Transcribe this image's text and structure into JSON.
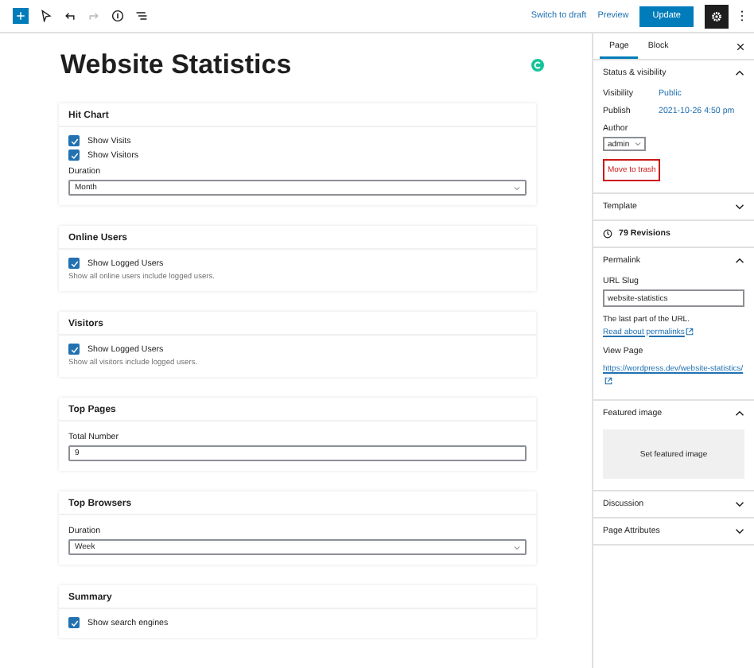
{
  "toolbar": {
    "switch_to_draft": "Switch to draft",
    "preview": "Preview",
    "update": "Update",
    "settings_selected": true
  },
  "title": "Website Statistics",
  "sections": [
    {
      "title": "Hit Chart",
      "fields": [
        {
          "kind": "checkbox",
          "label": "Show Visits",
          "checked": true
        },
        {
          "kind": "checkbox",
          "label": "Show Visitors",
          "checked": true
        },
        {
          "kind": "select",
          "label": "Duration",
          "value": "Month"
        }
      ]
    },
    {
      "title": "Online Users",
      "fields": [
        {
          "kind": "checkbox",
          "label": "Show Logged Users",
          "checked": true
        },
        {
          "kind": "help",
          "text": "Show all online users include logged users."
        }
      ]
    },
    {
      "title": "Visitors",
      "fields": [
        {
          "kind": "checkbox",
          "label": "Show Logged Users",
          "checked": true
        },
        {
          "kind": "help",
          "text": "Show all visitors include logged users."
        }
      ]
    },
    {
      "title": "Top Pages",
      "fields": [
        {
          "kind": "number",
          "label": "Total Number",
          "value": "9"
        }
      ]
    },
    {
      "title": "Top Browsers",
      "fields": [
        {
          "kind": "select",
          "label": "Duration",
          "value": "Week"
        }
      ]
    },
    {
      "title": "Summary",
      "fields": [
        {
          "kind": "checkbox",
          "label": "Show search engines",
          "checked": true
        }
      ]
    }
  ],
  "sidebar": {
    "tabs": [
      {
        "label": "Page",
        "selected": true
      },
      {
        "label": "Block",
        "selected": false
      }
    ],
    "panels": [
      {
        "kind": "status",
        "title": "Status & visibility",
        "expanded": true,
        "rows": [
          {
            "label": "Visibility",
            "value": "Public"
          },
          {
            "label": "Publish",
            "value": "2021-10-26 4:50 pm"
          }
        ],
        "author_label": "Author",
        "author": "admin",
        "trash": "Move to trash"
      },
      {
        "kind": "plain",
        "title": "Template",
        "expanded": false
      },
      {
        "kind": "revisions",
        "text": "79 Revisions"
      },
      {
        "kind": "permalink",
        "title": "Permalink",
        "expanded": true,
        "slug_label": "URL Slug",
        "slug": "website-statistics",
        "help": "The last part of the URL.",
        "help_link": "Read about permalinks",
        "view_label": "View Page",
        "url": "https://wordpress.dev/website-statistics/"
      },
      {
        "kind": "featured",
        "title": "Featured image",
        "expanded": true,
        "button": "Set featured image"
      },
      {
        "kind": "plain",
        "title": "Discussion",
        "expanded": false
      },
      {
        "kind": "plain",
        "title": "Page Attributes",
        "expanded": false
      }
    ]
  }
}
